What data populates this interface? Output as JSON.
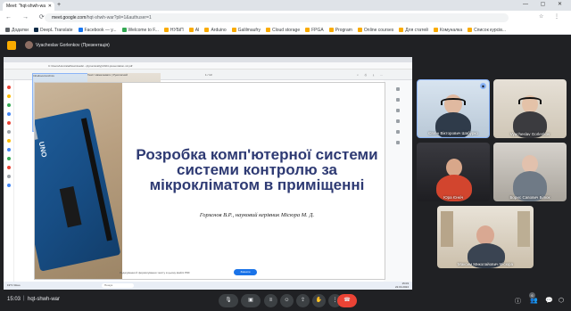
{
  "browser": {
    "tab_title": "Meet: \"hqt-shwh-wa",
    "url_domain": "meet.google.com",
    "url_path": "/hqt-shwh-war?pli=1&authuser=1",
    "bookmarks": [
      {
        "label": "Додатки",
        "color": "#5f6368"
      },
      {
        "label": "DeepL Translate",
        "color": "#0f2b46"
      },
      {
        "label": "Facebook — y...",
        "color": "#1877f2"
      },
      {
        "label": "Welcome to F...",
        "color": "#34a853"
      },
      {
        "label": "НУБіП",
        "color": "#f9ab00"
      },
      {
        "label": "AI",
        "color": "#f9ab00"
      },
      {
        "label": "Arduino",
        "color": "#f9ab00"
      },
      {
        "label": "Galilmaufry",
        "color": "#f9ab00"
      },
      {
        "label": "Cloud storage",
        "color": "#f9ab00"
      },
      {
        "label": "FPGA",
        "color": "#f9ab00"
      },
      {
        "label": "Program",
        "color": "#f9ab00"
      },
      {
        "label": "Online courses",
        "color": "#f9ab00"
      },
      {
        "label": "Для статей",
        "color": "#f9ab00"
      },
      {
        "label": "Комуналка",
        "color": "#f9ab00"
      },
      {
        "label": "Список курсів...",
        "color": "#f9ab00"
      }
    ]
  },
  "presenter": {
    "label": "Vyacheslav Gorlenkov (Презентація)"
  },
  "shared_screen": {
    "address": "C:/Users/Honzala/Downloads/...(dynamically)/2024-presentation-v2.pdf",
    "toolbar_left": "Inhaltsverzeichnis",
    "toolbar_mid": "Текст   Намалювати   | Рукописний",
    "page_indicator": "1 / 13",
    "status_text": "Редагування й форматування тексту в цьому файлі PDF",
    "status_button": "Змінити",
    "slide": {
      "title": "Розробка комп'ютерної системи системи контролю за мікрокліматом в приміщенні",
      "subtitle": "Горлєнов В.Р., науковий керівник Місюра М. Д.",
      "board_label": "UNO"
    },
    "taskbar": {
      "weather": "19°C Ясно",
      "search": "Пошук",
      "clock_time": "15:03",
      "clock_date": "22.04.2024",
      "app_colors": [
        "#0078d4",
        "#f9ab00",
        "#1e88e5",
        "#34a853",
        "#ea4335",
        "#7b1fa2",
        "#0f9d58",
        "#ff6d00"
      ]
    }
  },
  "participants": [
    {
      "name": "Євген Вікторович Шабурко",
      "speaking": true
    },
    {
      "name": "Vyacheslav Gorlenkov",
      "speaking": false
    },
    {
      "name": "Юра Єнкіч",
      "speaking": false
    },
    {
      "name": "Борис Савович Білюк",
      "speaking": false
    },
    {
      "name": "Максим Миколайович Місюра",
      "speaking": false
    }
  ],
  "meetbar": {
    "time": "15:03",
    "code": "hqt-shwh-war",
    "participant_count": "6"
  }
}
